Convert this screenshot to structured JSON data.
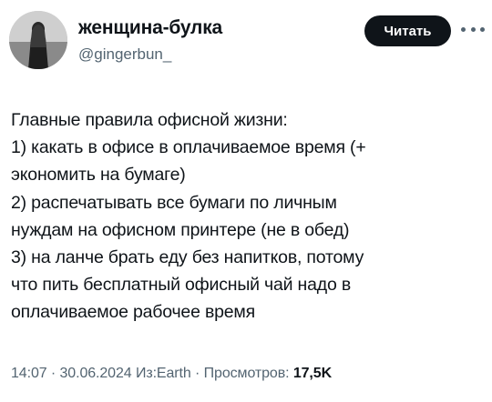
{
  "author": {
    "display_name": "женщина-булка",
    "handle": "@gingerbun_"
  },
  "follow_button_label": "Читать",
  "more_icon": "more-horizontal-icon",
  "tweet": {
    "lines": [
      "Главные правила офисной жизни:",
      "1) какать в офисе в оплачиваемое время (+",
      "экономить на бумаге)",
      "2) распечатывать все бумаги по личным",
      "нуждам на офисном принтере (не в обед)",
      "3) на ланче брать еду без напитков, потому",
      "что пить бесплатный офисный чай надо в",
      "оплачиваемое рабочее время"
    ]
  },
  "meta": {
    "time": "14:07",
    "separator": "·",
    "date": "30.06.2024",
    "source": "Из:Earth",
    "views_label": "Просмотров:",
    "views_count": "17,5K"
  },
  "colors": {
    "text": "#0f1419",
    "secondary": "#536471",
    "button_bg": "#0f1419",
    "button_text": "#ffffff"
  }
}
